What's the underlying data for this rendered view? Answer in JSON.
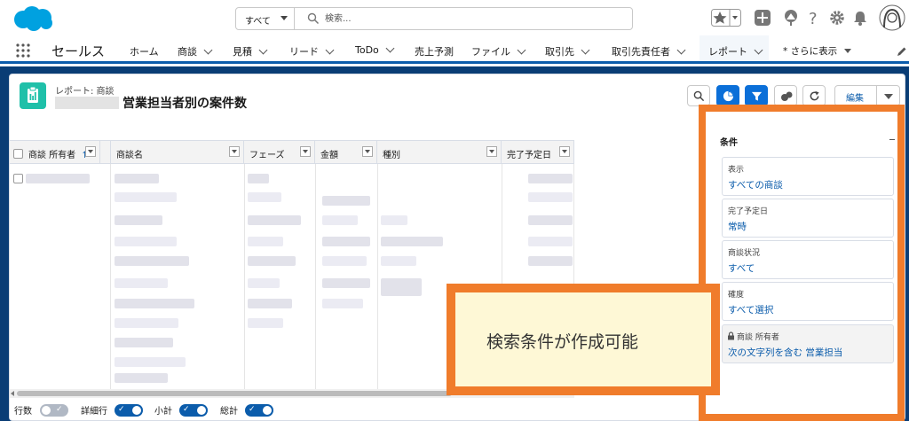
{
  "global_header": {
    "search": {
      "scope": "すべて",
      "placeholder": "検索..."
    },
    "icons": [
      "favorites-star-icon",
      "favorites-dropdown-icon",
      "global-add-icon",
      "trailhead-icon",
      "help-icon",
      "setup-gear-icon",
      "notifications-bell-icon",
      "user-avatar"
    ]
  },
  "nav": {
    "app_name": "セールス",
    "items": [
      {
        "label": "ホーム",
        "dropdown": false
      },
      {
        "label": "商談",
        "dropdown": true
      },
      {
        "label": "見積",
        "dropdown": true
      },
      {
        "label": "リード",
        "dropdown": true
      },
      {
        "label": "ToDo",
        "dropdown": true
      },
      {
        "label": "売上予測",
        "dropdown": false
      },
      {
        "label": "ファイル",
        "dropdown": true
      },
      {
        "label": "取引先",
        "dropdown": true
      },
      {
        "label": "取引先責任者",
        "dropdown": true
      },
      {
        "label": "レポート",
        "dropdown": true,
        "active": true
      }
    ],
    "more_label": "* さらに表示"
  },
  "report": {
    "breadcrumb": "レポート: 商談",
    "title": "営業担当者別の案件数",
    "edit_label": "編集"
  },
  "grid": {
    "columns": [
      "商談 所有者",
      "商談名",
      "フェーズ",
      "金額",
      "種別",
      "完了予定日"
    ],
    "sort_indicator": "↑"
  },
  "footer": {
    "toggles": [
      {
        "label": "行数",
        "on": false
      },
      {
        "label": "詳細行",
        "on": true
      },
      {
        "label": "小計",
        "on": true
      },
      {
        "label": "総計",
        "on": true
      }
    ]
  },
  "filters": {
    "title": "条件",
    "items": [
      {
        "label": "表示",
        "value": "すべての商談",
        "locked": false
      },
      {
        "label": "完了予定日",
        "value": "常時",
        "locked": false
      },
      {
        "label": "商談状況",
        "value": "すべて",
        "locked": false
      },
      {
        "label": "確度",
        "value": "すべて選択",
        "locked": false
      },
      {
        "label": "商談 所有者",
        "value": "次の文字列を含む 営業担当",
        "locked": true
      }
    ]
  },
  "callout": {
    "text": "検索条件が作成可能"
  },
  "colors": {
    "brand_blue": "#0b5cab",
    "header_band": "#0a3d75",
    "highlight_orange": "#f07c2b",
    "report_icon": "#1fc0a9"
  }
}
